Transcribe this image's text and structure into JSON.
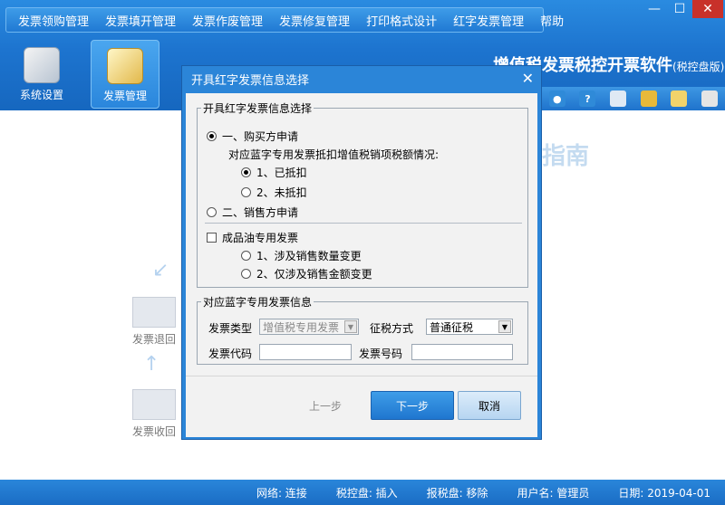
{
  "menu": [
    "发票领购管理",
    "发票填开管理",
    "发票作废管理",
    "发票修复管理",
    "打印格式设计",
    "红字发票管理",
    "帮助"
  ],
  "window_controls": [
    "—",
    "☐",
    "✕"
  ],
  "toolbar": {
    "system_settings": "系统设置",
    "invoice_management": "发票管理"
  },
  "brand": {
    "title": "增值税发票税控开票软件",
    "edition": "(税控盘版)"
  },
  "background": {
    "guide": "指南",
    "invoice_return": "发票退回",
    "invoice_recall": "发票收回"
  },
  "dialog": {
    "title": "开具红字发票信息选择",
    "close": "✕",
    "select_group": {
      "legend": "开具红字发票信息选择",
      "buyer_apply": "一、购买方申请",
      "deduction_question": "对应蓝字专用发票抵扣增值税销项税额情况:",
      "deducted": "1、已抵扣",
      "not_deducted": "2、未抵扣",
      "seller_apply": "二、销售方申请",
      "oil_invoice": "成品油专用发票",
      "oil_quantity_change": "1、涉及销售数量变更",
      "oil_amount_change": "2、仅涉及销售金额变更"
    },
    "info_group": {
      "legend": "对应蓝字专用发票信息",
      "invoice_type_label": "发票类型",
      "invoice_type_value": "增值税专用发票",
      "tax_method_label": "征税方式",
      "tax_method_value": "普通征税",
      "invoice_code_label": "发票代码",
      "invoice_number_label": "发票号码"
    },
    "buttons": {
      "prev": "上一步",
      "next": "下一步",
      "cancel": "取消"
    }
  },
  "status": {
    "network": "网络: 连接",
    "tax_disk": "税控盘: 插入",
    "report_disk": "报税盘: 移除",
    "user": "用户名: 管理员",
    "date": "日期: 2019-04-01"
  }
}
